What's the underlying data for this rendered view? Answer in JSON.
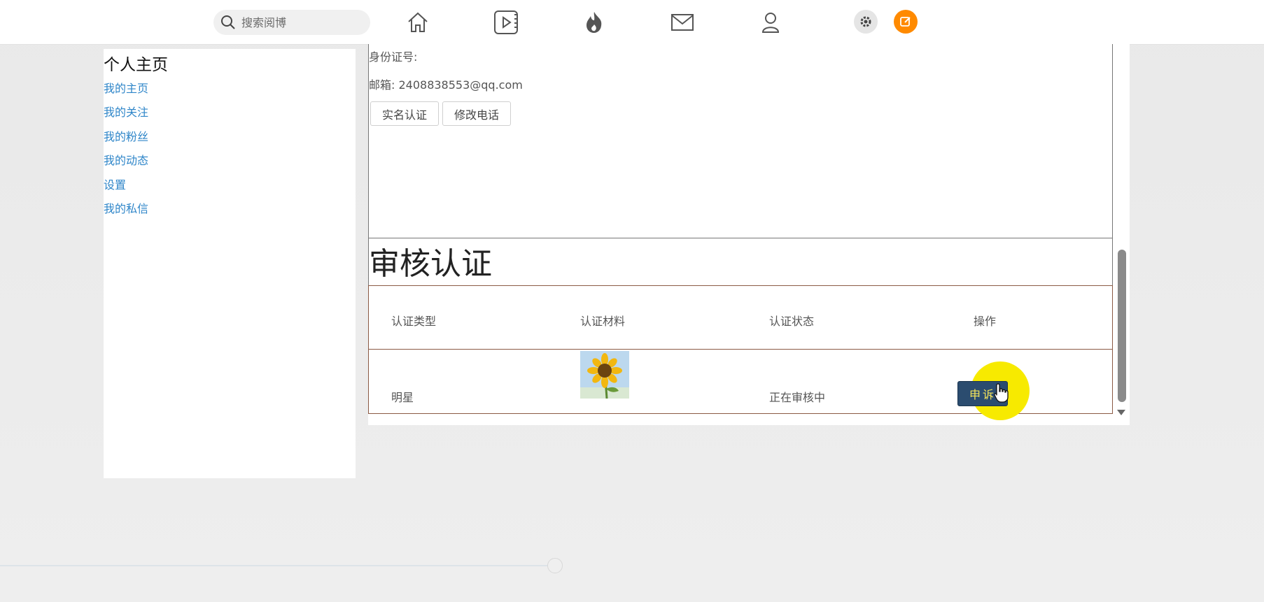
{
  "topbar": {
    "search_placeholder": "搜索阅博",
    "icons": [
      "home-icon",
      "video-icon",
      "hot-icon",
      "mail-icon",
      "user-icon",
      "settings-icon",
      "compose-icon"
    ],
    "accent_color": "#ff8a00"
  },
  "sidebar": {
    "title": "个人主页",
    "items": [
      {
        "label": "我的主页"
      },
      {
        "label": "我的关注"
      },
      {
        "label": "我的粉丝"
      },
      {
        "label": "我的动态"
      },
      {
        "label": "设置"
      },
      {
        "label": "我的私信"
      }
    ],
    "link_color": "#2f86c9"
  },
  "profile": {
    "id_label": "身份证号:",
    "email_label": "邮箱: 2408838553@qq.com",
    "buttons": {
      "real_name": "实名认证",
      "change_phone": "修改电话"
    }
  },
  "review": {
    "title": "审核认证",
    "columns": [
      "认证类型",
      "认证材料",
      "认证状态",
      "操作"
    ],
    "rows": [
      {
        "type": "明星",
        "material": "sunflower-image",
        "status": "正在审核中",
        "action": "申诉"
      }
    ]
  }
}
